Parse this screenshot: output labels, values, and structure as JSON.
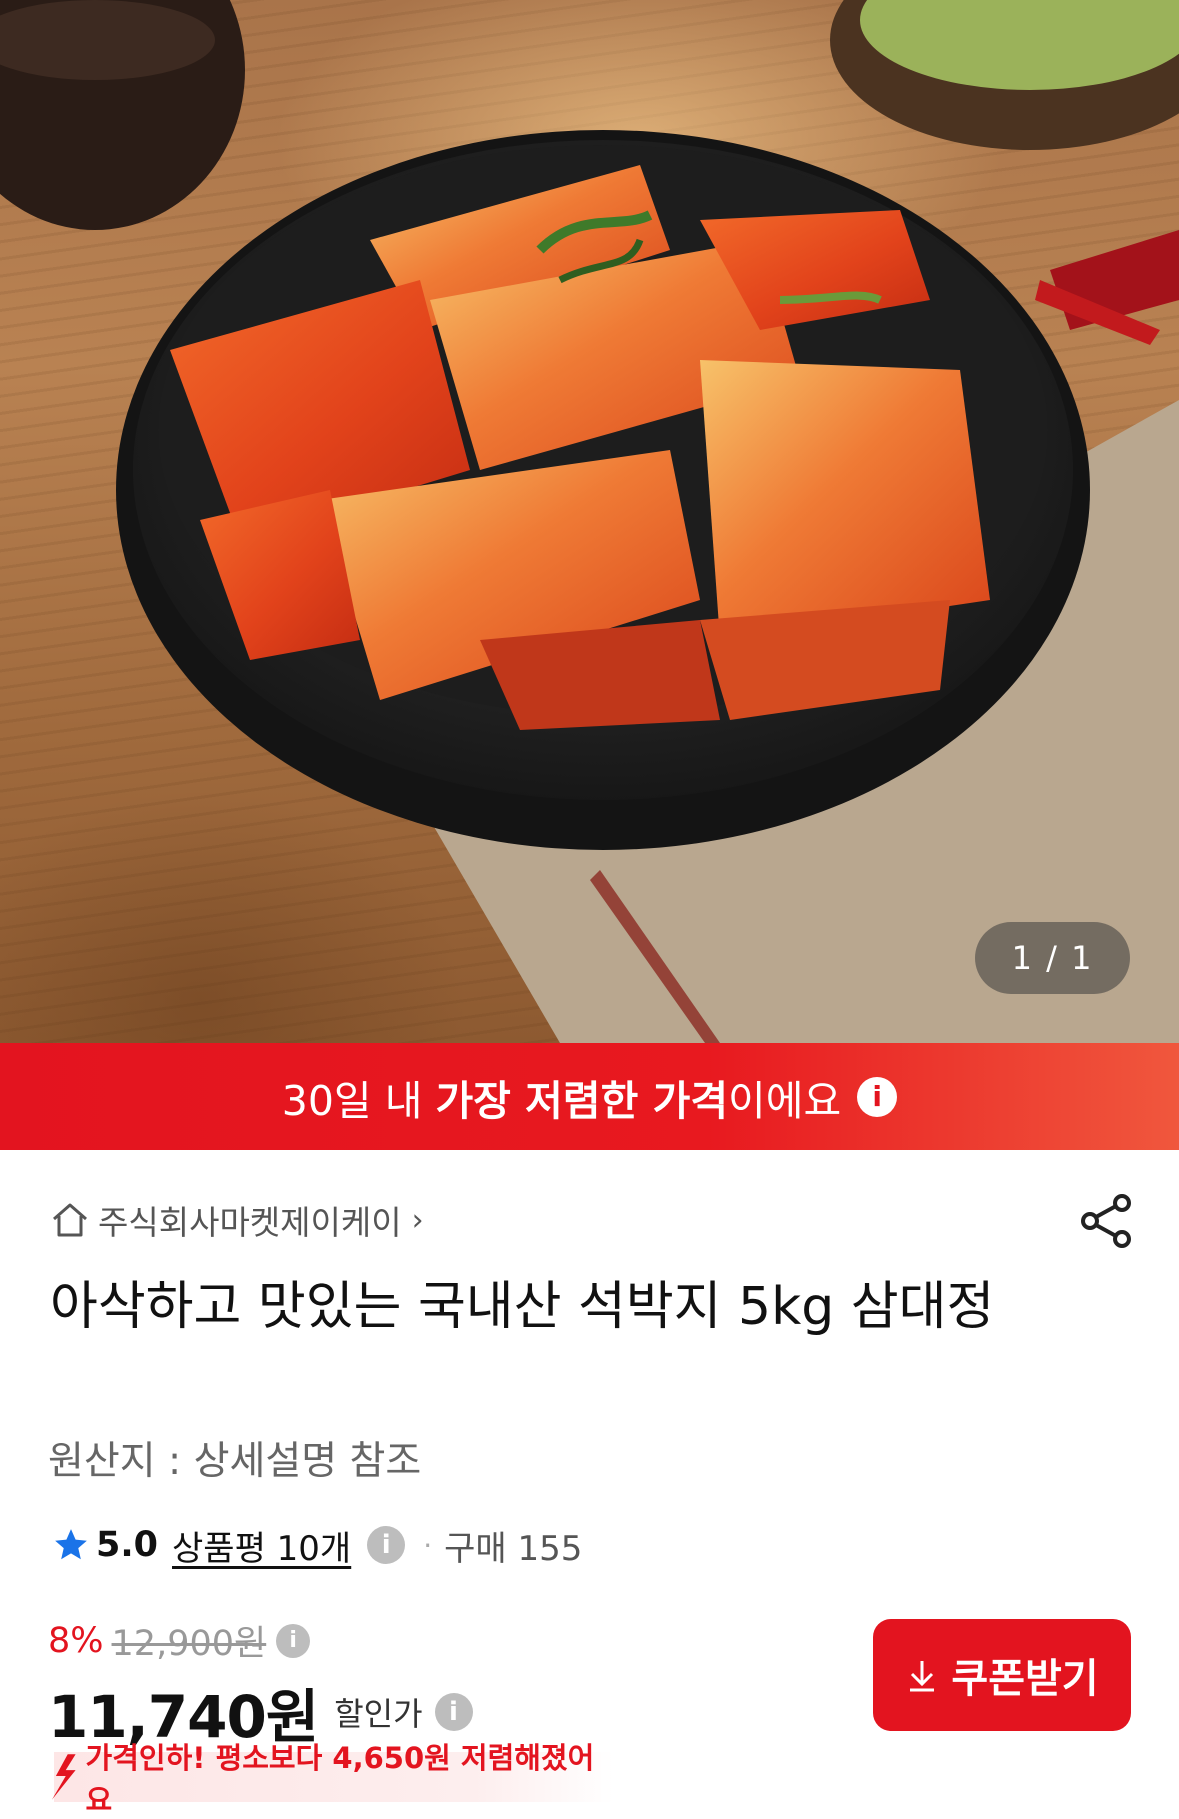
{
  "image": {
    "counter": "1 / 1",
    "icon": "kkakdugi-product-photo"
  },
  "banner": {
    "prefix": "30일 내 ",
    "bold": "가장 저렴한 가격",
    "suffix": "이에요",
    "info_icon": "info-icon"
  },
  "seller": {
    "name": "주식회사마켓제이케이",
    "icon": "home-icon"
  },
  "product": {
    "title": "아삭하고 맛있는 국내산 석박지 5kg 삼대정",
    "origin": "원산지 : 상세설명 참조"
  },
  "rating": {
    "score": "5.0",
    "reviews": "상품평 10개",
    "purchases": "구매 155"
  },
  "pricing": {
    "discount_pct": "8%",
    "original_price": "12,900원",
    "sale_price": "11,740원",
    "sale_label": "할인가",
    "coupon_label": "쿠폰받기",
    "price_drop": "가격인하! 평소보다 4,650원 저렴해졌어요"
  },
  "colors": {
    "accent": "#e3141f",
    "star": "#1a73e8"
  }
}
